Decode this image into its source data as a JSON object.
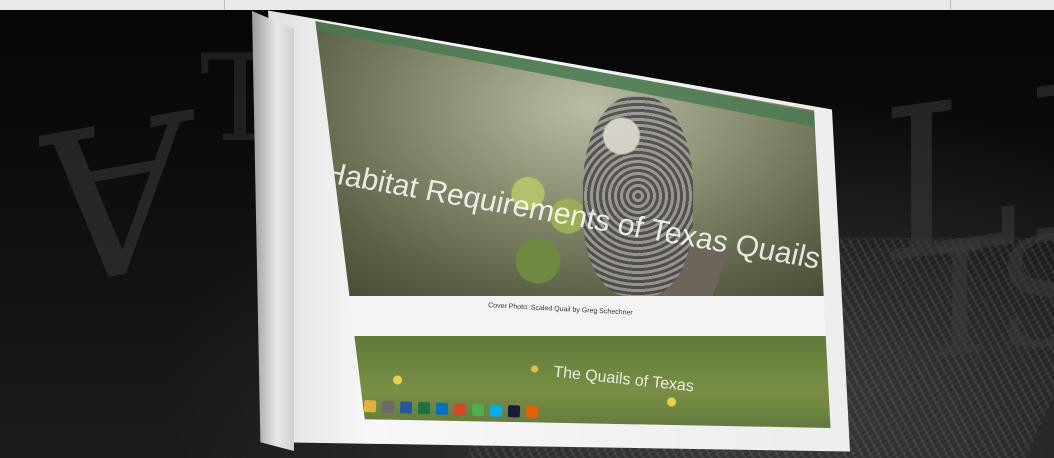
{
  "hero": {
    "title": "Habitat Requirements of Texas Quails"
  },
  "caption": {
    "text": "Cover Photo: Scaled Quail by Greg Schechner"
  },
  "section": {
    "title": "The Quails of Texas"
  },
  "colors": {
    "background": "#0a0a0a",
    "bezel": "#f2f2f2",
    "browser_accent": "#4a7a52"
  },
  "taskbar_icons": [
    "start-icon",
    "ie-icon",
    "folder-icon",
    "media-icon",
    "word-icon",
    "excel-icon",
    "outlook-icon",
    "powerpoint-icon",
    "chrome-icon",
    "skype-icon",
    "photoshop-icon",
    "firefox-icon"
  ]
}
